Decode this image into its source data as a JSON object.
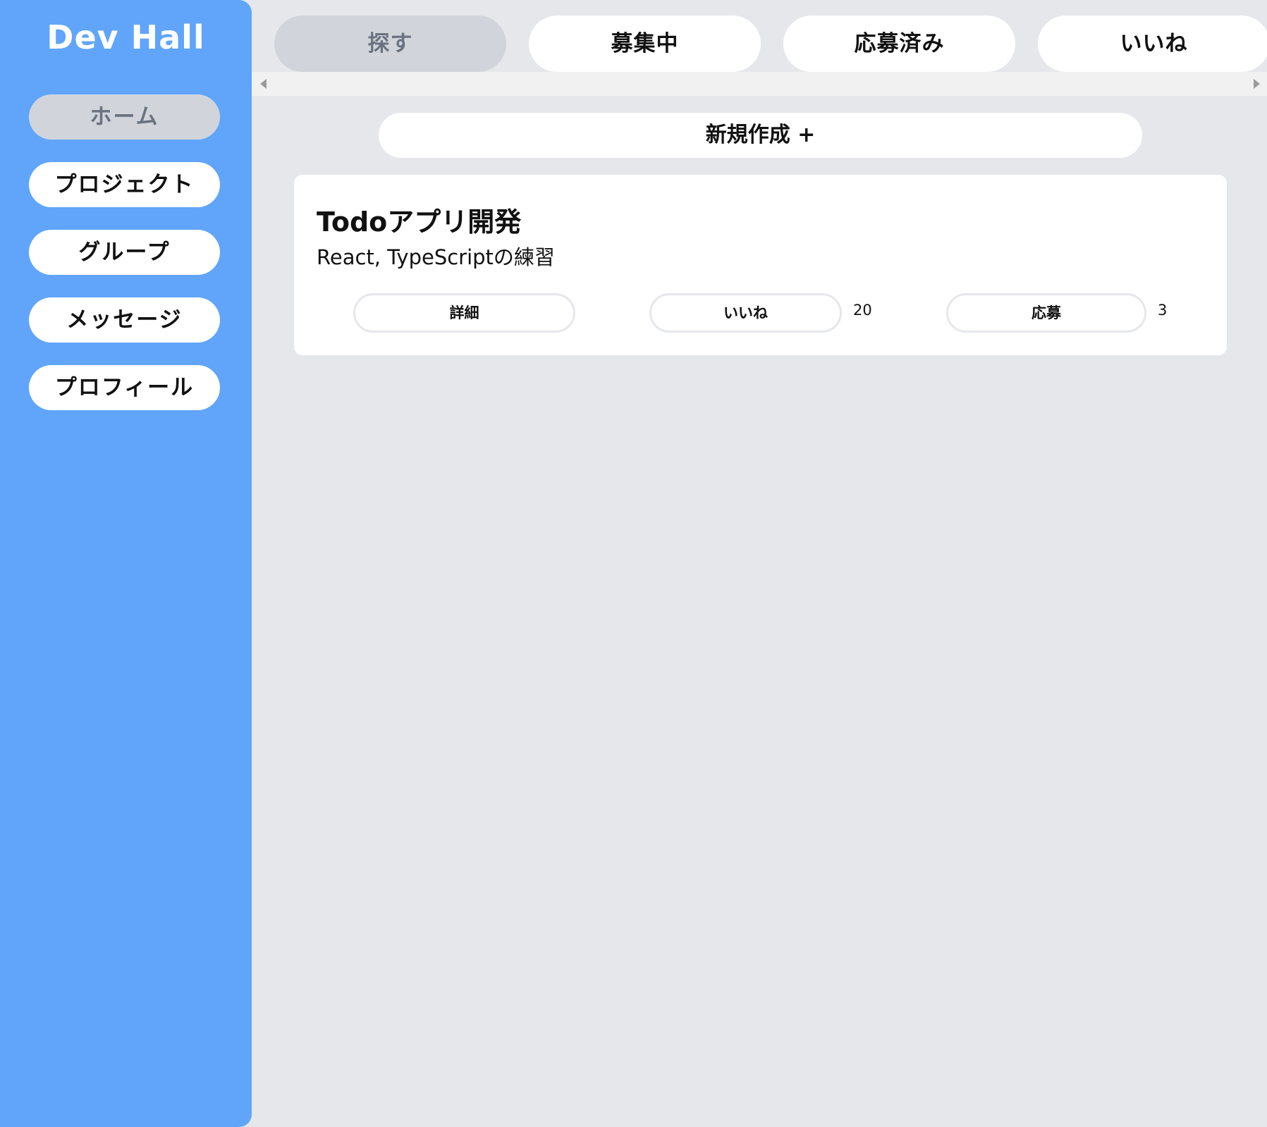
{
  "app": {
    "logo": "Dev Hall"
  },
  "sidebar": {
    "items": [
      {
        "label": "ホーム",
        "active": true
      },
      {
        "label": "プロジェクト",
        "active": false
      },
      {
        "label": "グループ",
        "active": false
      },
      {
        "label": "メッセージ",
        "active": false
      },
      {
        "label": "プロフィール",
        "active": false
      }
    ]
  },
  "tabs": [
    {
      "label": "探す",
      "active": true
    },
    {
      "label": "募集中",
      "active": false
    },
    {
      "label": "応募済み",
      "active": false
    },
    {
      "label": "いいね",
      "active": false
    }
  ],
  "main": {
    "new_button": "新規作成 +",
    "projects": [
      {
        "title": "Todoアプリ開発",
        "description": "React, TypeScriptの練習",
        "detail_label": "詳細",
        "like_label": "いいね",
        "like_count": "20",
        "apply_label": "応募",
        "apply_count": "3"
      }
    ]
  },
  "colors": {
    "sidebar_bg": "#60a5fa",
    "page_bg": "#e5e7eb",
    "active_bg": "#d1d5db",
    "active_text": "#6b7280"
  }
}
